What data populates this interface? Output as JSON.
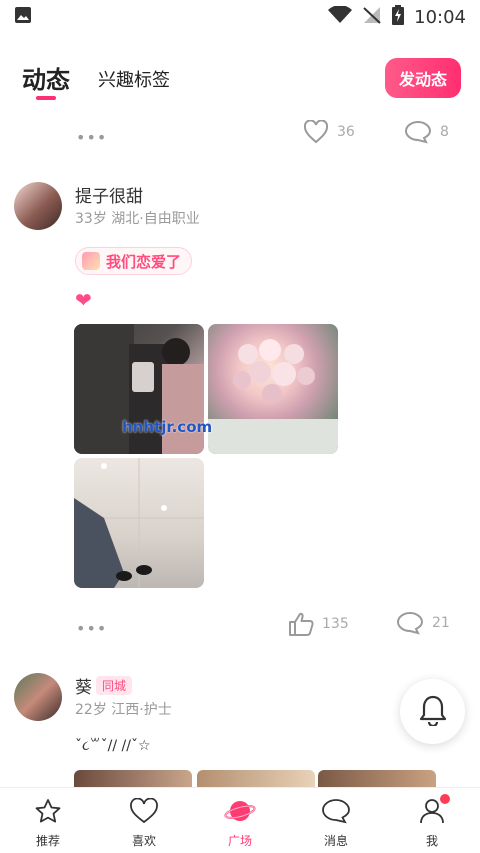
{
  "status_bar": {
    "time": "10:04",
    "icons": [
      "image-icon",
      "wifi-icon",
      "no-signal-icon",
      "battery-charging-icon"
    ]
  },
  "header": {
    "tabs": [
      {
        "label": "动态",
        "active": true
      },
      {
        "label": "兴趣标签",
        "active": false
      }
    ],
    "post_button": "发动态"
  },
  "feed": {
    "top_actions": {
      "likes": "36",
      "comments": "8"
    },
    "post1": {
      "name": "提子很甜",
      "meta": "33岁 湖北·自由职业",
      "tag": "我们恋爱了",
      "text_emoji": "❤",
      "watermark": "hnhtjr.com",
      "likes": "135",
      "comments": "21"
    },
    "post2": {
      "name": "葵",
      "badge": "同城",
      "meta": "22岁 江西·护士",
      "text": "ˇ૮꒳ˇ// //ˇ☆"
    }
  },
  "bottom_nav": [
    {
      "label": "推荐",
      "icon": "star-icon",
      "active": false
    },
    {
      "label": "喜欢",
      "icon": "heart-icon",
      "active": false
    },
    {
      "label": "广场",
      "icon": "planet-icon",
      "active": true
    },
    {
      "label": "消息",
      "icon": "chat-icon",
      "active": false
    },
    {
      "label": "我",
      "icon": "user-icon",
      "active": false,
      "dot": true
    }
  ],
  "colors": {
    "accent": "#ff2f73",
    "muted": "#9a9a9a"
  }
}
